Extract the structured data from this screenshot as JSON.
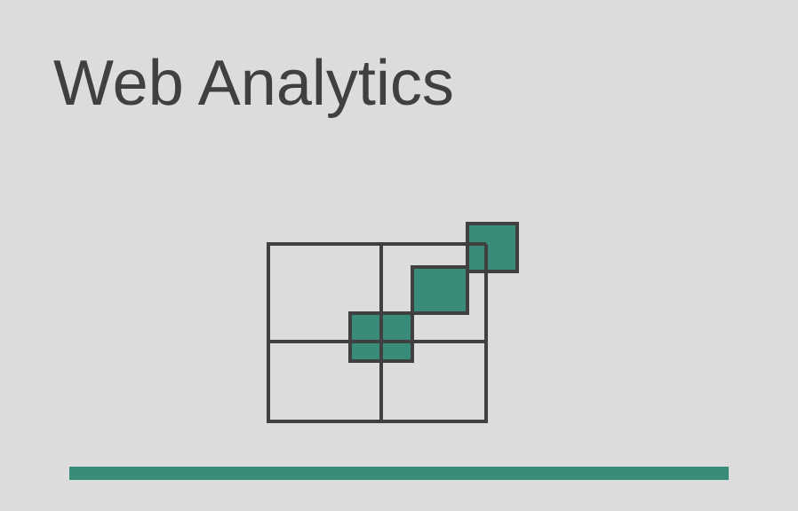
{
  "page": {
    "title": "Web Analytics"
  },
  "icon": {
    "name": "analytics-grid-icon",
    "stroke_color": "#404040",
    "fill_color": "#3a8c7a"
  },
  "accent_bar": {
    "color": "#3a8c7a"
  },
  "background_color": "#dcdcdc"
}
